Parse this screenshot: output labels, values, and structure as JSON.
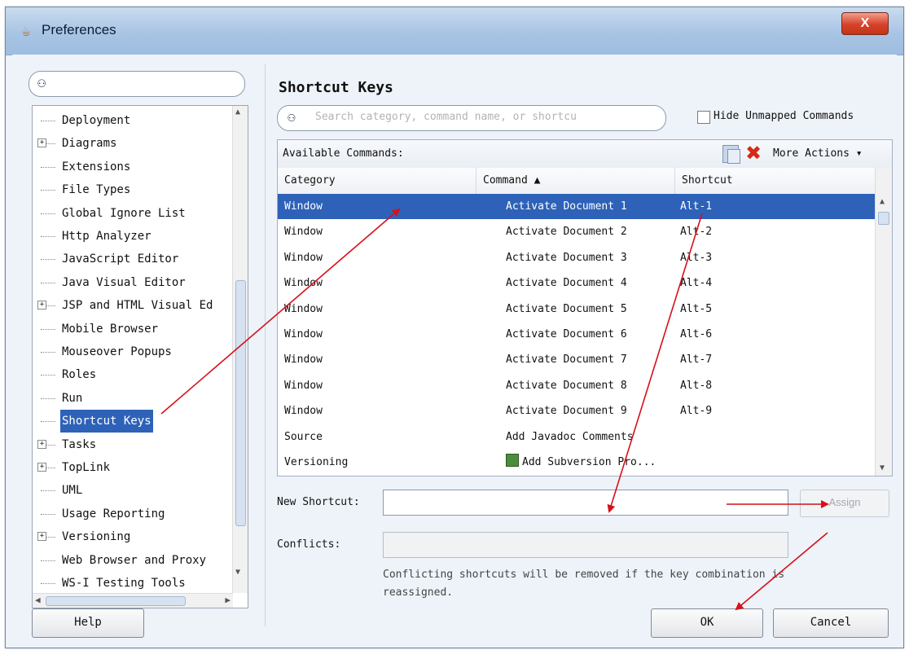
{
  "window": {
    "title": "Preferences",
    "close_label": "X"
  },
  "left_panel": {
    "search_placeholder": "",
    "tree_items": [
      {
        "label": "Deployment",
        "expandable": false
      },
      {
        "label": "Diagrams",
        "expandable": true
      },
      {
        "label": "Extensions",
        "expandable": false
      },
      {
        "label": "File Types",
        "expandable": false
      },
      {
        "label": "Global Ignore List",
        "expandable": false
      },
      {
        "label": "Http Analyzer",
        "expandable": false
      },
      {
        "label": "JavaScript Editor",
        "expandable": false
      },
      {
        "label": "Java Visual Editor",
        "expandable": false
      },
      {
        "label": "JSP and HTML Visual Ed",
        "expandable": true
      },
      {
        "label": "Mobile Browser",
        "expandable": false
      },
      {
        "label": "Mouseover Popups",
        "expandable": false
      },
      {
        "label": "Roles",
        "expandable": false
      },
      {
        "label": "Run",
        "expandable": false
      },
      {
        "label": "Shortcut Keys",
        "expandable": false,
        "selected": true
      },
      {
        "label": "Tasks",
        "expandable": true
      },
      {
        "label": "TopLink",
        "expandable": true
      },
      {
        "label": "UML",
        "expandable": false
      },
      {
        "label": "Usage Reporting",
        "expandable": false
      },
      {
        "label": "Versioning",
        "expandable": true
      },
      {
        "label": "Web Browser and Proxy",
        "expandable": false
      },
      {
        "label": "WS-I Testing Tools",
        "expandable": false
      }
    ]
  },
  "right_panel": {
    "heading": "Shortcut Keys",
    "search_placeholder": "Search category, command name, or shortcu",
    "hide_unmapped_label": "Hide Unmapped Commands",
    "available_commands_label": "Available Commands:",
    "more_actions_label": "More Actions ▾",
    "columns": {
      "category": "Category",
      "command": "Command ▲",
      "shortcut": "Shortcut"
    },
    "rows": [
      {
        "category": "Window",
        "command": "Activate Document 1",
        "shortcut": "Alt-1",
        "selected": true
      },
      {
        "category": "Window",
        "command": "Activate Document 2",
        "shortcut": "Alt-2"
      },
      {
        "category": "Window",
        "command": "Activate Document 3",
        "shortcut": "Alt-3"
      },
      {
        "category": "Window",
        "command": "Activate Document 4",
        "shortcut": "Alt-4"
      },
      {
        "category": "Window",
        "command": "Activate Document 5",
        "shortcut": "Alt-5"
      },
      {
        "category": "Window",
        "command": "Activate Document 6",
        "shortcut": "Alt-6"
      },
      {
        "category": "Window",
        "command": "Activate Document 7",
        "shortcut": "Alt-7"
      },
      {
        "category": "Window",
        "command": "Activate Document 8",
        "shortcut": "Alt-8"
      },
      {
        "category": "Window",
        "command": "Activate Document 9",
        "shortcut": "Alt-9"
      },
      {
        "category": "Source",
        "command": "Add Javadoc Comments",
        "shortcut": ""
      },
      {
        "category": "Versioning",
        "command": "Add Subversion Pro...",
        "shortcut": "",
        "icon": "subversion-icon"
      }
    ],
    "new_shortcut_label": "New Shortcut:",
    "new_shortcut_value": "",
    "assign_label": "Assign",
    "conflicts_label": "Conflicts:",
    "conflicts_value": "",
    "conflicts_note": "Conflicting shortcuts will be removed if the key combination is reassigned."
  },
  "footer": {
    "help_label": "Help",
    "ok_label": "OK",
    "cancel_label": "Cancel"
  },
  "colors": {
    "selection": "#2e62b8",
    "annotation_arrow": "#d6101a",
    "title_bar": "#a9c4e4"
  }
}
